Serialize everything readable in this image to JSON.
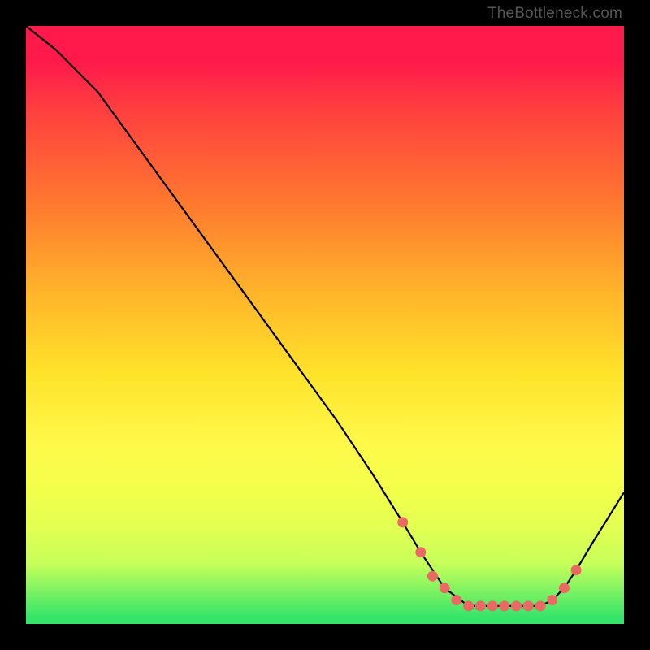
{
  "watermark": "TheBottleneck.com",
  "chart_data": {
    "type": "line",
    "title": "",
    "xlabel": "",
    "ylabel": "",
    "xlim": [
      0,
      100
    ],
    "ylim": [
      0,
      100
    ],
    "grid": false,
    "legend": false,
    "series": [
      {
        "name": "curve",
        "color": "#000000",
        "x": [
          0,
          5,
          12,
          20,
          28,
          36,
          44,
          52,
          58,
          63,
          66,
          70,
          74,
          78,
          82,
          86,
          88,
          90,
          92,
          95,
          100
        ],
        "y": [
          100,
          96,
          89,
          78,
          67,
          56,
          45,
          34,
          25,
          17,
          12,
          6,
          3,
          3,
          3,
          3,
          4,
          6,
          9,
          14,
          22
        ]
      }
    ],
    "markers": {
      "name": "dots",
      "color": "#e86a63",
      "x": [
        63,
        66,
        68,
        70,
        72,
        74,
        76,
        78,
        80,
        82,
        84,
        86,
        88,
        90,
        92
      ],
      "y": [
        17,
        12,
        8,
        6,
        4,
        3,
        3,
        3,
        3,
        3,
        3,
        3,
        4,
        6,
        9
      ]
    }
  }
}
